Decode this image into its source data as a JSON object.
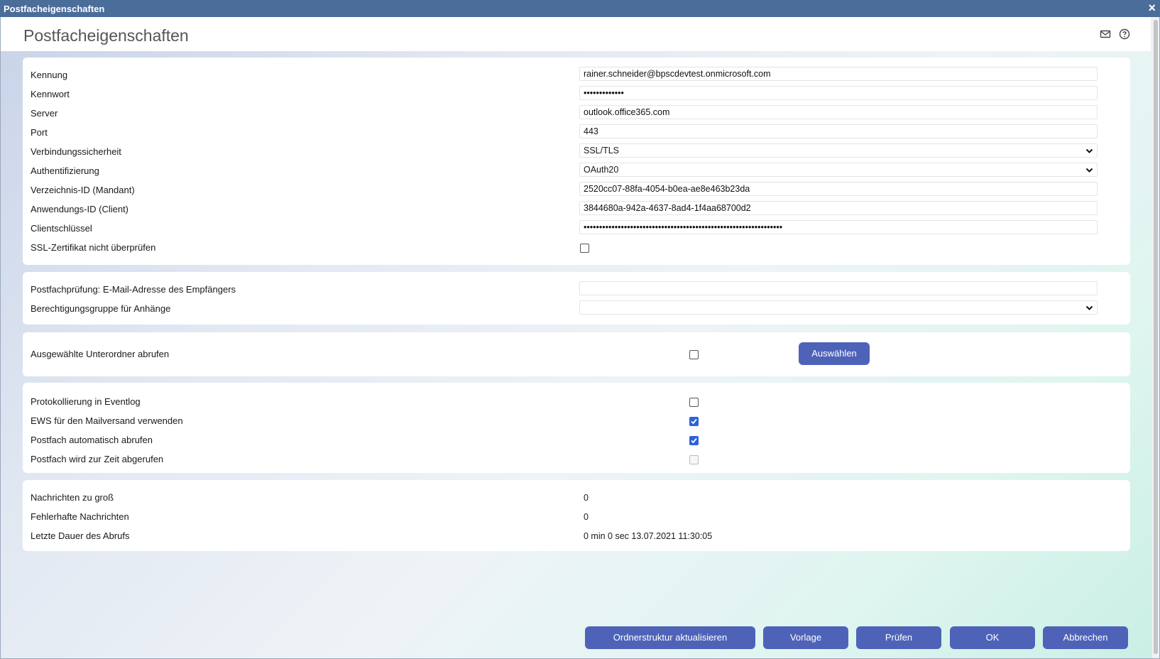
{
  "window": {
    "title": "Postfacheigenschaften",
    "close": "×"
  },
  "header": {
    "title": "Postfacheigenschaften",
    "icons": [
      "mail-icon",
      "help-icon"
    ]
  },
  "connection": {
    "identifier": {
      "label": "Kennung",
      "value": "rainer.schneider@bpscdevtest.onmicrosoft.com"
    },
    "password": {
      "label": "Kennwort",
      "value": "•••••••••••••"
    },
    "server": {
      "label": "Server",
      "value": "outlook.office365.com"
    },
    "port": {
      "label": "Port",
      "value": "443"
    },
    "security": {
      "label": "Verbindungssicherheit",
      "value": "SSL/TLS"
    },
    "auth": {
      "label": "Authentifizierung",
      "value": "OAuth20"
    },
    "tenant": {
      "label": "Verzeichnis-ID (Mandant)",
      "value": "2520cc07-88fa-4054-b0ea-ae8e463b23da"
    },
    "client": {
      "label": "Anwendungs-ID (Client)",
      "value": "3844680a-942a-4637-8ad4-1f4aa68700d2"
    },
    "secret": {
      "label": "Clientschlüssel",
      "value": "••••••••••••••••••••••••••••••••••••••••••••••••••••••••••••••••"
    },
    "ssl_skip": {
      "label": "SSL-Zertifikat nicht überprüfen",
      "checked": false
    }
  },
  "check": {
    "email": {
      "label": "Postfachprüfung: E-Mail-Adresse des Empfängers",
      "value": ""
    },
    "group": {
      "label": "Berechtigungsgruppe für Anhänge",
      "value": ""
    }
  },
  "subfolders": {
    "label": "Ausgewählte Unterordner abrufen",
    "checked": false,
    "button": "Auswählen"
  },
  "options": {
    "eventlog": {
      "label": "Protokollierung in Eventlog",
      "checked": false
    },
    "ews": {
      "label": "EWS für den Mailversand verwenden",
      "checked": true
    },
    "auto": {
      "label": "Postfach automatisch abrufen",
      "checked": true
    },
    "busy": {
      "label": "Postfach wird zur Zeit abgerufen",
      "checked": false,
      "disabled": true
    }
  },
  "stats": {
    "too_big": {
      "label": "Nachrichten zu groß",
      "value": "0"
    },
    "faulty": {
      "label": "Fehlerhafte Nachrichten",
      "value": "0"
    },
    "last": {
      "label": "Letzte Dauer des Abrufs",
      "value": "0 min 0 sec 13.07.2021 11:30:05"
    }
  },
  "footer": {
    "refresh": "Ordnerstruktur aktualisieren",
    "template": "Vorlage",
    "test": "Prüfen",
    "ok": "OK",
    "cancel": "Abbrechen"
  },
  "colors": {
    "titlebar": "#4a6d9a",
    "button": "#4e63b8",
    "checkbox_on": "#2b63d9"
  }
}
